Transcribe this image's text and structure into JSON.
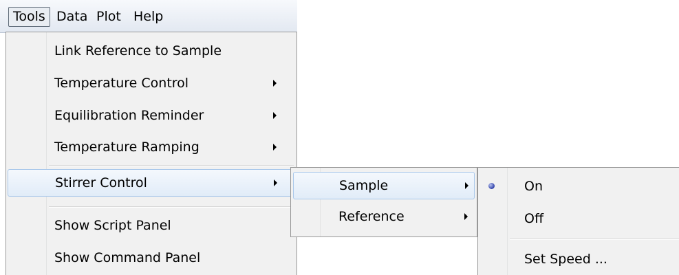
{
  "menubar": {
    "items": [
      {
        "label": "Tools",
        "active": true
      },
      {
        "label": "Data"
      },
      {
        "label": "Plot"
      },
      {
        "label": "Help"
      }
    ]
  },
  "tools_menu": {
    "items": [
      {
        "label": "Link Reference to Sample"
      },
      {
        "label": "Temperature Control",
        "submenu": true
      },
      {
        "label": "Equilibration Reminder",
        "submenu": true
      },
      {
        "label": "Temperature Ramping",
        "submenu": true
      },
      {
        "label": "Stirrer Control",
        "submenu": true,
        "highlighted": true
      },
      {
        "label": "Show Script Panel"
      },
      {
        "label": "Show Command Panel"
      }
    ]
  },
  "stirrer_menu": {
    "items": [
      {
        "label": "Sample",
        "submenu": true,
        "highlighted": true
      },
      {
        "label": "Reference",
        "submenu": true
      }
    ]
  },
  "sample_menu": {
    "items": [
      {
        "label": "On",
        "selected": true
      },
      {
        "label": "Off"
      },
      {
        "label": "Set Speed ..."
      }
    ]
  }
}
